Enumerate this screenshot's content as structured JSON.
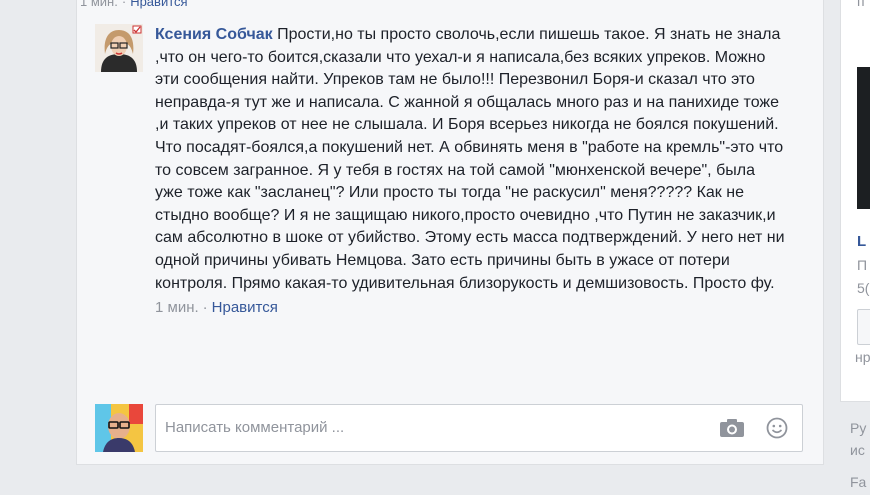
{
  "top_meta": {
    "time": "1 мин.",
    "separator": "·",
    "like": "Нравится"
  },
  "comment": {
    "author": "Ксения Собчак",
    "text": "Прости,но ты просто сволочь,если пишешь такое. Я знать не знала ,что он чего-то боится,сказали что уехал-и я написала,без всяких упреков. Можно эти сообщения найти. Упреков там не было!!! Перезвонил Боря-и сказал что это неправда-я тут же и написала. С жанной я общалась много раз и на панихиде тоже ,и таких упреков от нее не слышала. И Боря всерьез никогда не боялся покушений. Что посадят-боялся,а покушений нет. А обвинять меня в \"работе на кремль\"-это что то совсем загранное. Я у тебя в гостях на той самой \"мюнхенской вечере\", была уже тоже как \"засланец\"? Или просто ты тогда \"не раскусил\" меня????? Как не стыдно вообще? И я не защищаю никого,просто очевидно ,что Путин не заказчик,и сам абсолютно в шоке от убийство. Этому есть масса подтверждений. У него нет ни одной причины убивать Немцова. Зато есть причины быть в ужасе от потери контроля. Прямо какая-то удивительная близорукость и демшизовость. Просто фу.",
    "time": "1 мин.",
    "separator": "·",
    "like": "Нравится"
  },
  "composer": {
    "placeholder": "Написать комментарий ...",
    "camera_icon": "camera-icon",
    "emoji_icon": "smiley-icon"
  },
  "right_column": {
    "top_partial": "п",
    "title_partial": "L",
    "line1_partial": "П",
    "line2_partial": "5(",
    "line3_partial": "нр",
    "footer1_partial": "Ру",
    "footer2_partial": "ис",
    "footer3_partial": "Fa"
  },
  "colors": {
    "link": "#365899",
    "meta": "#90949c",
    "text": "#1d2129",
    "background": "#e9ebee"
  }
}
